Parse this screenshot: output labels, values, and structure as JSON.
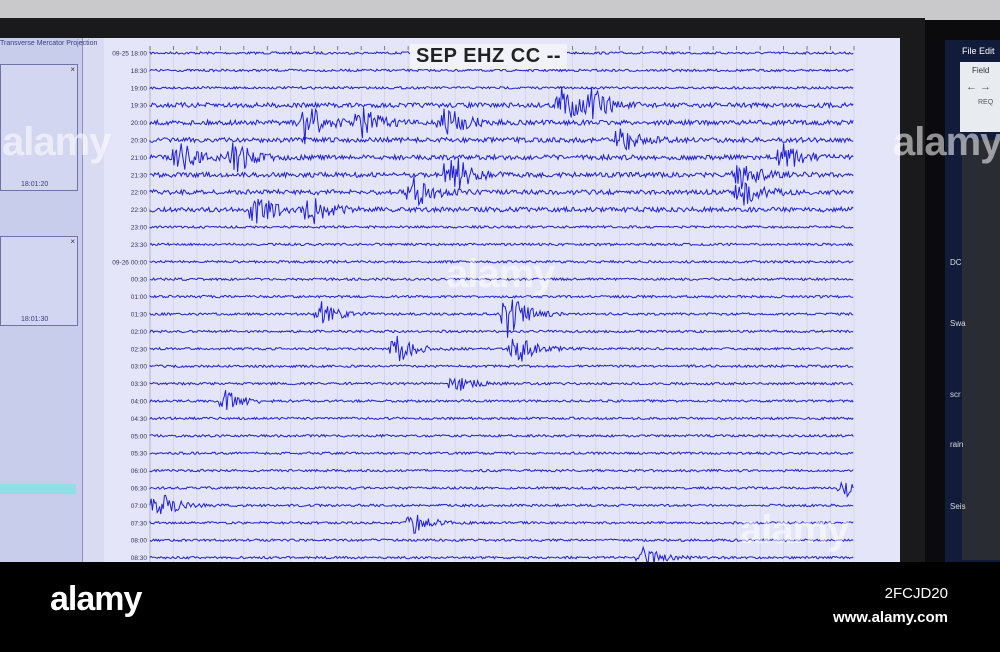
{
  "screen": {
    "projection_label": "Transverse Mercator Projection",
    "subwindow_times": [
      "18:01:20",
      "18:01:30"
    ]
  },
  "right_monitor": {
    "menu": [
      "File",
      "Edit"
    ],
    "labels": [
      "Field",
      "REQ",
      "DC",
      "Swa",
      "scr",
      "rain",
      "Seis"
    ]
  },
  "footer": {
    "logo": "alamy",
    "image_id": "2FCJD20",
    "site": "www.alamy.com"
  },
  "watermark": "alamy",
  "colors": {
    "trace": "#1f1fd6",
    "plot_bg": "#e4e5f8"
  },
  "chart_data": {
    "type": "helicorder",
    "title": "SEP EHZ CC --",
    "x_unit": "minutes",
    "xlim": [
      0,
      30
    ],
    "row_labels": [
      "09-25 18:00",
      "18:30",
      "19:00",
      "19:30",
      "20:00",
      "20:30",
      "21:00",
      "21:30",
      "22:00",
      "22:30",
      "23:00",
      "23:30",
      "09-26 00:00",
      "00:30",
      "01:00",
      "01:30",
      "02:00",
      "02:30",
      "03:00",
      "03:30",
      "04:00",
      "04:30",
      "05:00",
      "05:30",
      "06:00",
      "06:30",
      "07:00",
      "07:30",
      "08:00",
      "08:30"
    ],
    "events": [
      {
        "row": 4,
        "minute": 6.5,
        "amp": 3
      },
      {
        "row": 4,
        "minute": 12.5,
        "amp": 2.5
      },
      {
        "row": 3,
        "minute": 17.5,
        "amp": 2.5
      },
      {
        "row": 3,
        "minute": 18.8,
        "amp": 2
      },
      {
        "row": 4,
        "minute": 9,
        "amp": 2
      },
      {
        "row": 6,
        "minute": 1.2,
        "amp": 2
      },
      {
        "row": 6,
        "minute": 3.5,
        "amp": 2.5
      },
      {
        "row": 5,
        "minute": 20,
        "amp": 1.8
      },
      {
        "row": 7,
        "minute": 12.8,
        "amp": 3
      },
      {
        "row": 8,
        "minute": 11.2,
        "amp": 2
      },
      {
        "row": 9,
        "minute": 4.5,
        "amp": 2.5
      },
      {
        "row": 9,
        "minute": 6.8,
        "amp": 2
      },
      {
        "row": 7,
        "minute": 25,
        "amp": 2
      },
      {
        "row": 8,
        "minute": 25.2,
        "amp": 1.8
      },
      {
        "row": 6,
        "minute": 27,
        "amp": 1.6
      },
      {
        "row": 15,
        "minute": 7.2,
        "amp": 1.6
      },
      {
        "row": 15,
        "minute": 15.2,
        "amp": 3
      },
      {
        "row": 17,
        "minute": 10.5,
        "amp": 1.8
      },
      {
        "row": 17,
        "minute": 15.5,
        "amp": 2.5
      },
      {
        "row": 20,
        "minute": 3.2,
        "amp": 1.3
      },
      {
        "row": 19,
        "minute": 13,
        "amp": 1
      },
      {
        "row": 26,
        "minute": 0.3,
        "amp": 1.8
      },
      {
        "row": 27,
        "minute": 11.2,
        "amp": 1.3
      },
      {
        "row": 29,
        "minute": 21,
        "amp": 1.3
      },
      {
        "row": 25,
        "minute": 29.5,
        "amp": 1.2
      }
    ]
  }
}
